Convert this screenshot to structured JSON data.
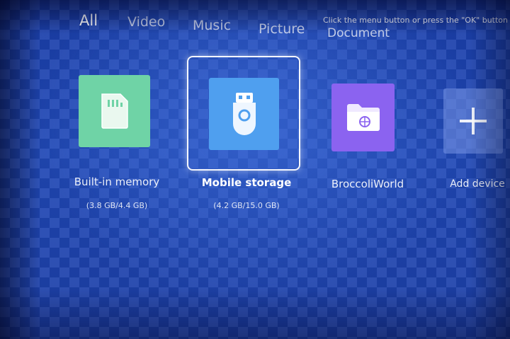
{
  "tabs": [
    {
      "label": "All",
      "active": true
    },
    {
      "label": "Video",
      "active": false
    },
    {
      "label": "Music",
      "active": false
    },
    {
      "label": "Picture",
      "active": false
    },
    {
      "label": "Document",
      "active": false
    }
  ],
  "hint": "Click the menu button or press the \"OK\" button on the",
  "devices": [
    {
      "name": "Built-in memory",
      "usage": "(3.8 GB/4.4 GB)",
      "icon": "sd-card-icon",
      "color": "#6fd3a6",
      "focused": false
    },
    {
      "name": "Mobile storage",
      "usage": "(4.2 GB/15.0 GB)",
      "icon": "usb-drive-icon",
      "color": "#4f9fef",
      "focused": true
    },
    {
      "name": "BroccoliWorld",
      "usage": "",
      "icon": "network-folder-icon",
      "color": "#8b63f0",
      "focused": false
    },
    {
      "name": "Add device",
      "usage": "",
      "icon": "plus-icon",
      "color": "#5a7fd6",
      "focused": false
    }
  ]
}
